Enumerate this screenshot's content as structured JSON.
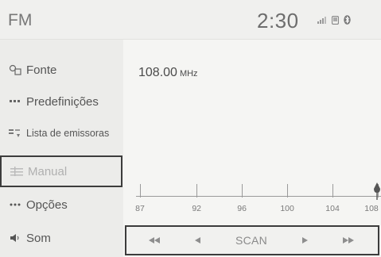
{
  "header": {
    "band": "FM",
    "clock": "2:30",
    "status_icons": [
      "signal-icon",
      "phone-icon",
      "bluetooth-icon"
    ]
  },
  "sidebar": {
    "items": [
      {
        "label": "Fonte",
        "icon": "source-icon"
      },
      {
        "label": "Predefinições",
        "icon": "presets-icon"
      },
      {
        "label": "Lista de emissoras",
        "icon": "station-list-icon"
      },
      {
        "label": "Manual",
        "icon": "manual-tune-icon",
        "selected": true
      },
      {
        "label": "Opções",
        "icon": "more-options-icon"
      },
      {
        "label": "Som",
        "icon": "speaker-icon"
      }
    ]
  },
  "tuner": {
    "frequency": "108.00",
    "unit": "MHz",
    "scale_labels": [
      "87",
      "92",
      "96",
      "100",
      "104",
      "108"
    ],
    "scale_min": 87,
    "scale_max": 108,
    "current": 108.0
  },
  "controls": {
    "seek_back": "seek-back-icon",
    "step_back": "step-back-icon",
    "scan_label": "SCAN",
    "step_forward": "step-forward-icon",
    "seek_forward": "seek-forward-icon"
  },
  "colors": {
    "highlight_border": "#3c3c3c",
    "background": "#f3f3f1",
    "sidebar": "#ececea"
  }
}
